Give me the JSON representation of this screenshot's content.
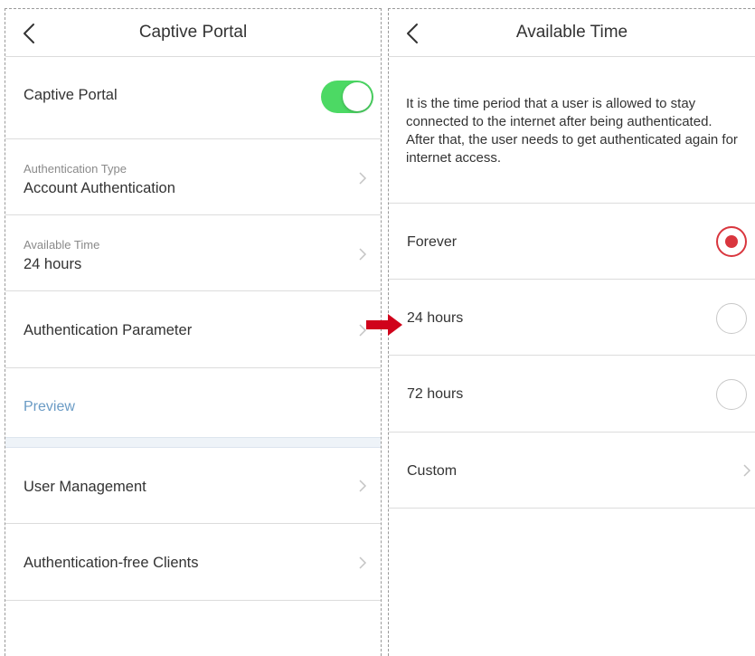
{
  "left_screen": {
    "title": "Captive Portal",
    "captive_portal": {
      "label": "Captive Portal",
      "enabled": true
    },
    "authentication_type": {
      "label": "Authentication Type",
      "value": "Account Authentication"
    },
    "available_time": {
      "label": "Available Time",
      "value": "24 hours"
    },
    "authentication_parameter": {
      "label": "Authentication Parameter"
    },
    "preview": {
      "label": "Preview"
    },
    "user_management": {
      "label": "User Management"
    },
    "authentication_free_clients": {
      "label": "Authentication-free Clients"
    }
  },
  "right_screen": {
    "title": "Available Time",
    "description": "It is the time period that a user is allowed to stay connected to the internet after being authenticated. After that, the user needs to get authenticated again for internet access.",
    "options": [
      {
        "label": "Forever",
        "selected": true
      },
      {
        "label": "24 hours",
        "selected": false
      },
      {
        "label": "72 hours",
        "selected": false
      },
      {
        "label": "Custom"
      }
    ]
  },
  "colors": {
    "toggle_on": "#4cd964",
    "radio_selected": "#d9363e",
    "preview_link": "#6a9bc5",
    "arrow": "#d0021b"
  },
  "icons": [
    "back-chevron-icon",
    "chevron-right-icon",
    "red-arrow-icon"
  ]
}
